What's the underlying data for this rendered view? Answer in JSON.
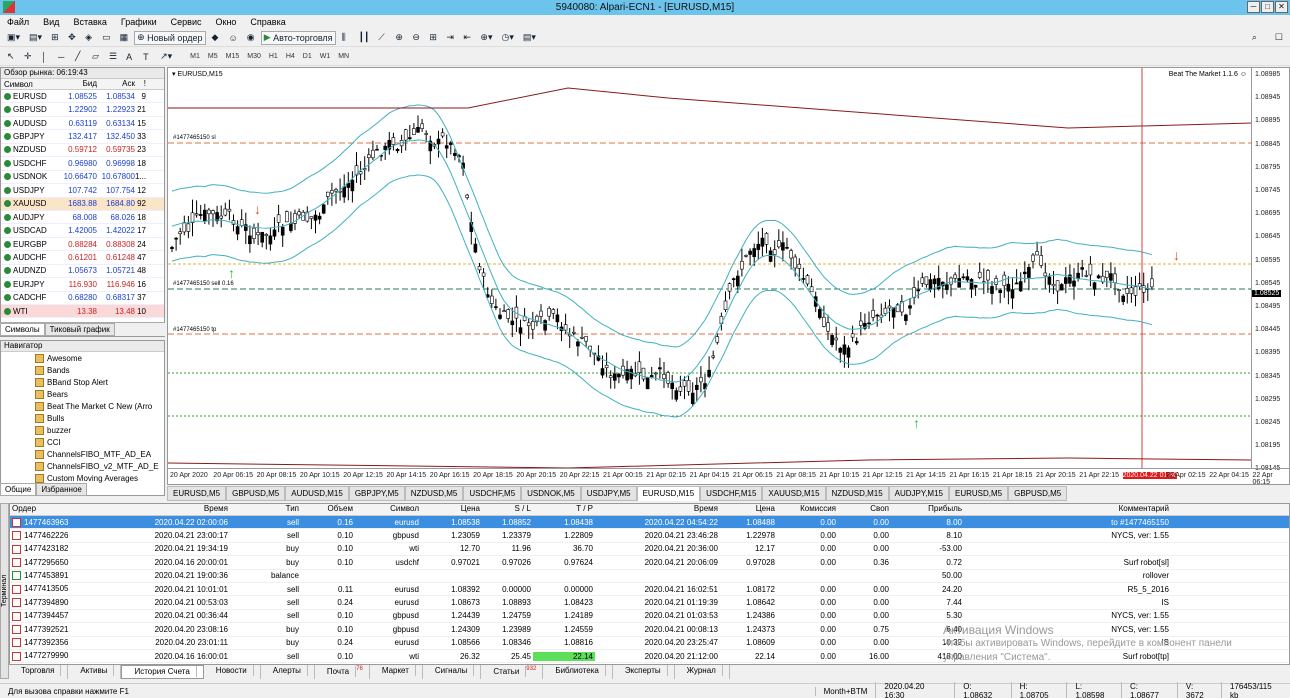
{
  "window": {
    "title": "5940080: Alpari-ECN1 - [EURUSD,M15]"
  },
  "menu": [
    "Файл",
    "Вид",
    "Вставка",
    "Графики",
    "Сервис",
    "Окно",
    "Справка"
  ],
  "toolbar": {
    "new_order": "Новый ордер",
    "autotrading": "Авто-торговля",
    "timeframes": [
      "M1",
      "M5",
      "M15",
      "M30",
      "H1",
      "H4",
      "D1",
      "W1",
      "MN"
    ]
  },
  "market_watch": {
    "title": "Обзор рынка: 06:19:43",
    "headers": [
      "Символ",
      "Бид",
      "Аск",
      "!"
    ],
    "rows": [
      {
        "s": "EURUSD",
        "b": "1.08525",
        "a": "1.08534",
        "sp": "9"
      },
      {
        "s": "GBPUSD",
        "b": "1.22902",
        "a": "1.22923",
        "sp": "21"
      },
      {
        "s": "AUDUSD",
        "b": "0.63119",
        "a": "0.63134",
        "sp": "15"
      },
      {
        "s": "GBPJPY",
        "b": "132.417",
        "a": "132.450",
        "sp": "33"
      },
      {
        "s": "NZDUSD",
        "b": "0.59712",
        "a": "0.59735",
        "sp": "23"
      },
      {
        "s": "USDCHF",
        "b": "0.96980",
        "a": "0.96998",
        "sp": "18"
      },
      {
        "s": "USDNOK",
        "b": "10.66470",
        "a": "10.67800",
        "sp": "1..."
      },
      {
        "s": "USDJPY",
        "b": "107.742",
        "a": "107.754",
        "sp": "12"
      },
      {
        "s": "XAUUSD",
        "b": "1683.88",
        "a": "1684.80",
        "sp": "92"
      },
      {
        "s": "AUDJPY",
        "b": "68.008",
        "a": "68.026",
        "sp": "18"
      },
      {
        "s": "USDCAD",
        "b": "1.42005",
        "a": "1.42022",
        "sp": "17"
      },
      {
        "s": "EURGBP",
        "b": "0.88284",
        "a": "0.88308",
        "sp": "24"
      },
      {
        "s": "AUDCHF",
        "b": "0.61201",
        "a": "0.61248",
        "sp": "47"
      },
      {
        "s": "AUDNZD",
        "b": "1.05673",
        "a": "1.05721",
        "sp": "48"
      },
      {
        "s": "EURJPY",
        "b": "116.930",
        "a": "116.946",
        "sp": "16"
      },
      {
        "s": "CADCHF",
        "b": "0.68280",
        "a": "0.68317",
        "sp": "37"
      },
      {
        "s": "WTI",
        "b": "13.38",
        "a": "13.48",
        "sp": "10"
      }
    ],
    "tabs": [
      "Символы",
      "Тиковый график"
    ]
  },
  "navigator": {
    "title": "Навигатор",
    "items": [
      "Awesome",
      "Bands",
      "BBand Stop Alert",
      "Bears",
      "Beat The Market C New (Arro",
      "Bulls",
      "buzzer",
      "CCI",
      "ChannelsFIBO_MTF_AD_EA",
      "ChannelsFIBO_v2_MTF_AD_E",
      "Custom Moving Averages"
    ],
    "tabs": [
      "Общие",
      "Избранное"
    ]
  },
  "chart": {
    "label": "EURUSD,M15",
    "indicator": "Beat The Market 1.1.6",
    "sl_label": "#1477465150 sl",
    "sell_label": "#1477465150 sell 0.16",
    "tp_label": "#1477465150 tp",
    "price_ticks": [
      "1.08985",
      "1.08945",
      "1.08895",
      "1.08845",
      "1.08795",
      "1.08745",
      "1.08695",
      "1.08645",
      "1.08595",
      "1.08545",
      "1.08495",
      "1.08445",
      "1.08395",
      "1.08345",
      "1.08295",
      "1.08245",
      "1.08195",
      "1.08145"
    ],
    "current_price": "1.08525",
    "time_ticks": [
      "20 Apr 2020",
      "20 Apr 06:15",
      "20 Apr 08:15",
      "20 Apr 10:15",
      "20 Apr 12:15",
      "20 Apr 14:15",
      "20 Apr 16:15",
      "20 Apr 18:15",
      "20 Apr 20:15",
      "20 Apr 22:15",
      "21 Apr 00:15",
      "21 Apr 02:15",
      "21 Apr 04:15",
      "21 Apr 06:15",
      "21 Apr 08:15",
      "21 Apr 10:15",
      "21 Apr 12:15",
      "21 Apr 14:15",
      "21 Apr 16:15",
      "21 Apr 18:15",
      "21 Apr 20:15",
      "21 Apr 22:15",
      "2020.04.22 01:30",
      "22 Apr 02:15",
      "22 Apr 04:15",
      "22 Apr 06:15"
    ]
  },
  "chart_tabs": [
    "EURUSD,M5",
    "GBPUSD,M5",
    "AUDUSD,M15",
    "GBPJPY,M5",
    "NZDUSD,M5",
    "USDCHF,M5",
    "USDNOK,M5",
    "USDJPY,M5",
    "EURUSD,M15",
    "USDCHF,M15",
    "XAUUSD,M15",
    "NZDUSD,M15",
    "AUDJPY,M15",
    "EURUSD,M5",
    "GBPUSD,M5"
  ],
  "terminal": {
    "headers": [
      "Ордер",
      "Время",
      "Тип",
      "Объем",
      "Символ",
      "Цена",
      "S / L",
      "T / P",
      "Время",
      "Цена",
      "Комиссия",
      "Своп",
      "Прибыль",
      "Комментарий"
    ],
    "rows": [
      [
        "1477463963",
        "2020.04.22 02:00:06",
        "sell",
        "0.16",
        "eurusd",
        "1.08538",
        "1.08852",
        "1.08438",
        "2020.04.22 04:54:22",
        "1.08488",
        "0.00",
        "0.00",
        "8.00",
        "to #1477465150"
      ],
      [
        "1477462226",
        "2020.04.21 23:00:17",
        "sell",
        "0.10",
        "gbpusd",
        "1.23059",
        "1.23379",
        "1.22809",
        "2020.04.21 23:46:28",
        "1.22978",
        "0.00",
        "0.00",
        "8.10",
        "NYCS, ver: 1.55"
      ],
      [
        "1477423182",
        "2020.04.21 19:34:19",
        "buy",
        "0.10",
        "wti",
        "12.70",
        "11.96",
        "36.70",
        "2020.04.21 20:36:00",
        "12.17",
        "0.00",
        "0.00",
        "-53.00",
        ""
      ],
      [
        "1477295650",
        "2020.04.16 20:00:01",
        "buy",
        "0.10",
        "usdchf",
        "0.97021",
        "0.97026",
        "0.97624",
        "2020.04.21 20:06:09",
        "0.97028",
        "0.00",
        "0.36",
        "0.72",
        "Surf robot[sl]"
      ],
      [
        "1477453891",
        "2020.04.21 19:00:36",
        "balance",
        "",
        "",
        "",
        "",
        "",
        "",
        "",
        "",
        "",
        "50.00",
        "rollover"
      ],
      [
        "1477413505",
        "2020.04.21 10:01:01",
        "sell",
        "0.11",
        "eurusd",
        "1.08392",
        "0.00000",
        "0.00000",
        "2020.04.21 16:02:51",
        "1.08172",
        "0.00",
        "0.00",
        "24.20",
        "R5_5_2016"
      ],
      [
        "1477394890",
        "2020.04.21 00:53:03",
        "sell",
        "0.24",
        "eurusd",
        "1.08673",
        "1.08893",
        "1.08423",
        "2020.04.21 01:19:39",
        "1.08642",
        "0.00",
        "0.00",
        "7.44",
        "IS"
      ],
      [
        "1477394457",
        "2020.04.21 00:36:44",
        "sell",
        "0.10",
        "gbpusd",
        "1.24439",
        "1.24759",
        "1.24189",
        "2020.04.21 01:03:53",
        "1.24386",
        "0.00",
        "0.00",
        "5.30",
        "NYCS, ver: 1.55"
      ],
      [
        "1477392521",
        "2020.04.20 23:08:16",
        "buy",
        "0.10",
        "gbpusd",
        "1.24309",
        "1.23989",
        "1.24559",
        "2020.04.21 00:08:13",
        "1.24373",
        "0.00",
        "0.75",
        "6.40",
        "NYCS, ver: 1.55"
      ],
      [
        "1477392356",
        "2020.04.20 23:01:11",
        "buy",
        "0.24",
        "eurusd",
        "1.08566",
        "1.08346",
        "1.08816",
        "2020.04.20 23:25:47",
        "1.08609",
        "0.00",
        "0.00",
        "10.32",
        "IS"
      ],
      [
        "1477279990",
        "2020.04.16 16:00:01",
        "sell",
        "0.10",
        "wti",
        "26.32",
        "25.45",
        "22.14",
        "2020.04.20 21:12:00",
        "22.14",
        "0.00",
        "16.00",
        "418.00",
        "Surf robot[tp]"
      ]
    ],
    "tabs": [
      "Торговля",
      "Активы",
      "История Счета",
      "Новости",
      "Алерты",
      "Почта",
      "Маркет",
      "Сигналы",
      "Статьи",
      "Библиотека",
      "Эксперты",
      "Журнал"
    ],
    "mail_badge": "76",
    "articles_badge": "932",
    "side_label": "Терминал"
  },
  "watermark": [
    "Активация Windows",
    "Чтобы активировать Windows, перейдите в компонент панели управления \"Система\"."
  ],
  "status": {
    "help": "Для вызова справки нажмите F1",
    "profile": "Month+BTM",
    "datetime": "2020.04.20 16:30",
    "open": "O: 1.08632",
    "high": "H: 1.08705",
    "low": "L: 1.08598",
    "close": "C: 1.08677",
    "volume": "V: 3672",
    "traffic": "176453/115 kb"
  },
  "colors": {
    "accent": "#3c8ee0",
    "titlebar": "#6cc3ec",
    "sl": "#e07040",
    "tp": "#30a030",
    "band": "#40b0c0"
  }
}
